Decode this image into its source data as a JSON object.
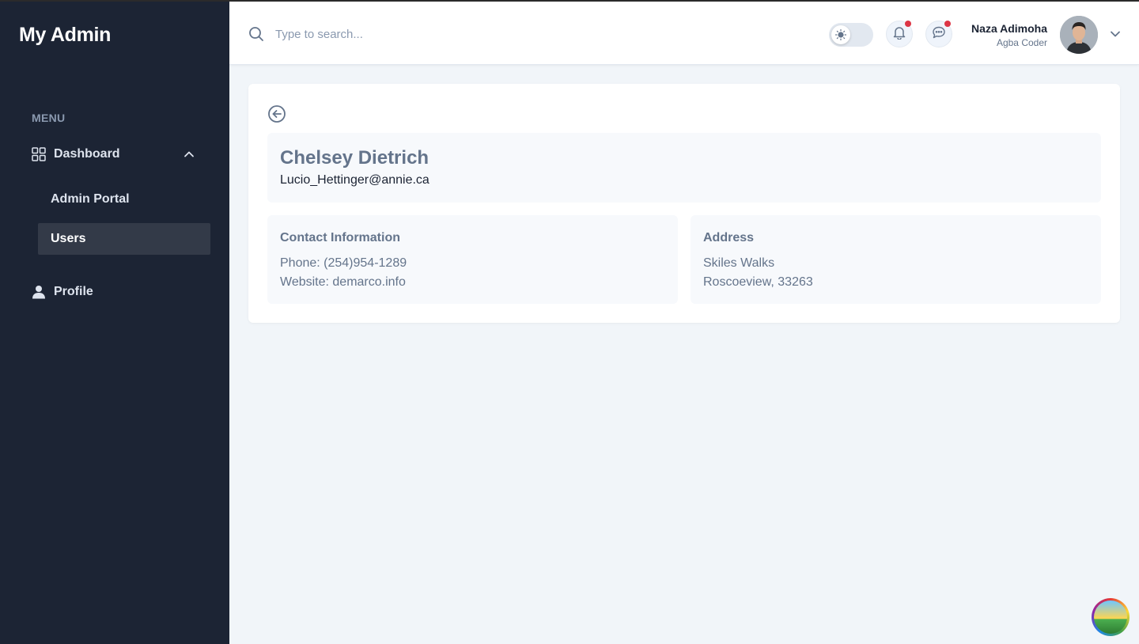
{
  "sidebar": {
    "brand": "My Admin",
    "menu_heading": "MENU",
    "dashboard_label": "Dashboard",
    "sub_items": [
      {
        "label": "Admin Portal"
      },
      {
        "label": "Users"
      }
    ],
    "profile_label": "Profile"
  },
  "header": {
    "search_placeholder": "Type to search...",
    "user": {
      "name": "Naza Adimoha",
      "role": "Agba Coder"
    }
  },
  "user_detail": {
    "name": "Chelsey Dietrich",
    "email": "Lucio_Hettinger@annie.ca",
    "contact": {
      "title": "Contact Information",
      "phone": "Phone: (254)954-1289",
      "website": "Website: demarco.info"
    },
    "address": {
      "title": "Address",
      "street": "Skiles Walks",
      "city_zip": "Roscoeview, 33263"
    }
  },
  "colors": {
    "sidebar_bg": "#1c2434",
    "page_bg": "#f1f5f9",
    "active_item_bg": "#333a48",
    "notification_dot": "#dc3545"
  }
}
